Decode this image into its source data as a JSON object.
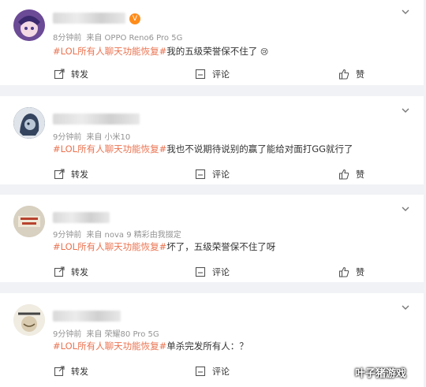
{
  "posts": [
    {
      "meta_time": "8分钟前",
      "meta_from": "来自 OPPO Reno6 Pro 5G",
      "topic": "#LOL所有人聊天功能恢复#",
      "text": "我的五级荣誉保不住了",
      "emoji": "😢",
      "actions": {
        "repost": "转发",
        "comment": "评论",
        "like": "赞"
      },
      "avatar_color": "#7d5aa6"
    },
    {
      "meta_time": "9分钟前",
      "meta_from": "来自 小米10",
      "topic": "#LOL所有人聊天功能恢复#",
      "text": "我也不说期待说别的赢了能给对面打GG就行了",
      "actions": {
        "repost": "转发",
        "comment": "评论",
        "like": "赞"
      },
      "avatar_color": "#3d4f6b"
    },
    {
      "meta_time": "9分钟前",
      "meta_from": "来自 nova 9 精彩由我掇定",
      "topic": "#LOL所有人聊天功能恢复#",
      "text": "坏了，五级荣誉保不住了呀",
      "actions": {
        "repost": "转发",
        "comment": "评论",
        "like": "赞"
      },
      "avatar_color": "#c9c2b3"
    },
    {
      "meta_time": "9分钟前",
      "meta_from": "来自 荣耀80 Pro 5G",
      "topic": "#LOL所有人聊天功能恢复#",
      "text": "单杀完发所有人：？",
      "actions": {
        "repost": "转发",
        "comment": "评论",
        "like": "赞"
      },
      "avatar_color": "#e6e0d2"
    }
  ],
  "watermark": "叶子猪游戏",
  "colors": {
    "topic": "#eb7350",
    "meta": "#939393",
    "background": "#f1f2f5"
  }
}
